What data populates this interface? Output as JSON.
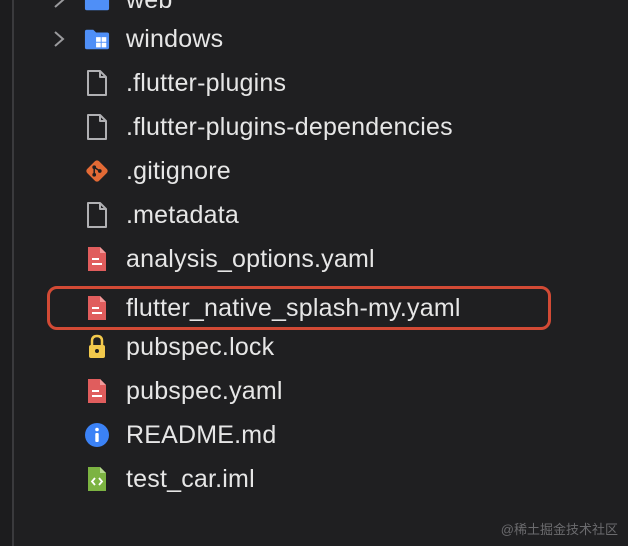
{
  "file_tree": {
    "items": [
      {
        "label": "web",
        "icon": "folder-icon",
        "expandable": true
      },
      {
        "label": "windows",
        "icon": "folder-icon",
        "expandable": true
      },
      {
        "label": ".flutter-plugins",
        "icon": "file-icon"
      },
      {
        "label": ".flutter-plugins-dependencies",
        "icon": "file-icon"
      },
      {
        "label": ".gitignore",
        "icon": "git-icon"
      },
      {
        "label": ".metadata",
        "icon": "file-icon"
      },
      {
        "label": "analysis_options.yaml",
        "icon": "yaml-file-icon"
      },
      {
        "label": "flutter_native_splash-my.yaml",
        "icon": "yaml-file-icon",
        "highlighted": true
      },
      {
        "label": "pubspec.lock",
        "icon": "lock-icon"
      },
      {
        "label": "pubspec.yaml",
        "icon": "yaml-file-icon"
      },
      {
        "label": "README.md",
        "icon": "info-icon"
      },
      {
        "label": "test_car.iml",
        "icon": "iml-file-icon"
      }
    ]
  },
  "watermark": "@稀土掘金技术社区",
  "colors": {
    "background": "#1f1f21",
    "text": "#e6e6e6",
    "highlight_border": "#d24a35",
    "folder": "#4f8ff7",
    "yaml": "#e05d5d",
    "git": "#e36a35",
    "lock": "#f2c94c",
    "info": "#3b82f6",
    "iml": "#7cb342"
  }
}
